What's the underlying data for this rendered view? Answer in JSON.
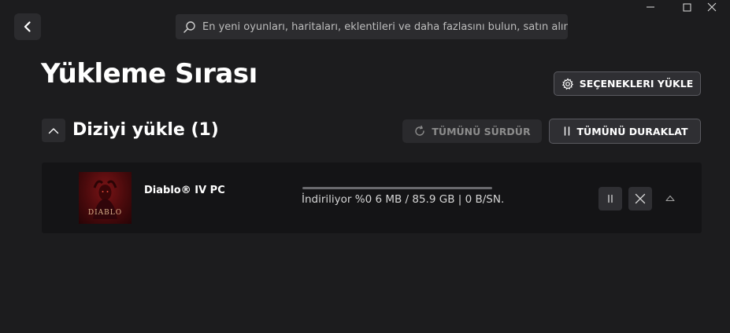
{
  "search": {
    "placeholder": "En yeni oyunları, haritaları, eklentileri ve daha fazlasını bulun, satın alın ve indirin"
  },
  "page": {
    "title": "Yükleme Sırası"
  },
  "buttons": {
    "install_options": "SEÇENEKLERI YÜKLE",
    "resume_all": "TÜMÜNÜ SÜRDÜR",
    "pause_all": "TÜMÜNÜ DURAKLAT"
  },
  "queue": {
    "title": "Diziyi yükle (1)",
    "items": [
      {
        "name": "Diablo® IV PC",
        "thumbnail_text": "DIABLO",
        "status": "İndiriliyor %0 6 MB / 85.9 GB  | 0 B/SN.",
        "progress": 0
      }
    ]
  },
  "icons": {
    "back": "chevron-left-icon",
    "search": "search-icon",
    "minimize": "minimize-icon",
    "maximize": "maximize-icon",
    "close": "close-icon",
    "gear": "gear-icon",
    "refresh": "refresh-icon",
    "pause": "pause-icon",
    "collapse": "chevron-up-icon",
    "expand": "triangle-up-icon"
  },
  "colors": {
    "background": "#1c1c1e",
    "row_background": "#141416",
    "button_background": "#2f2f33"
  }
}
